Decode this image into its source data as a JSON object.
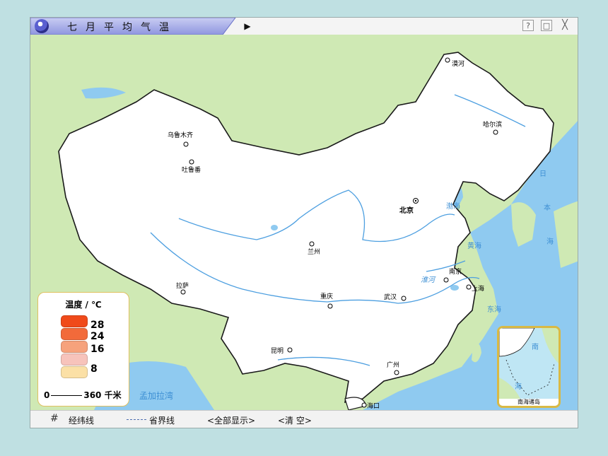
{
  "window": {
    "title": "七月平均气温",
    "help_button": "?",
    "restore_button": "□",
    "close_button": "╳",
    "play_button": "▶"
  },
  "map": {
    "cities": [
      {
        "name": "漠河"
      },
      {
        "name": "哈尔滨"
      },
      {
        "name": "乌鲁木齐"
      },
      {
        "name": "吐鲁番"
      },
      {
        "name": "北京"
      },
      {
        "name": "兰州"
      },
      {
        "name": "拉萨"
      },
      {
        "name": "重庆"
      },
      {
        "name": "武汉"
      },
      {
        "name": "南京"
      },
      {
        "name": "上海"
      },
      {
        "name": "昆明"
      },
      {
        "name": "广州"
      },
      {
        "name": "海口"
      }
    ],
    "water_labels": {
      "bohai": "渤海",
      "huanghai": "黄海",
      "donghai": "东海",
      "nanhai_1": "南",
      "nanhai_2": "海",
      "ri_1": "日",
      "ri_2": "本",
      "ri_3": "海",
      "menggala": "孟加拉湾",
      "huaihe": "淮河"
    },
    "inset": {
      "label": "南海诸岛",
      "nan": "南",
      "hai": "海"
    }
  },
  "legend": {
    "title": "温度 / ℃",
    "items": [
      {
        "value": "28",
        "color": "#f04a1a"
      },
      {
        "value": "24",
        "color": "#f26a3a"
      },
      {
        "value": "16",
        "color": "#f6a27c"
      },
      {
        "value": "",
        "color": "#f7c3bb"
      },
      {
        "value": "8",
        "color": "#fbe0a6"
      }
    ],
    "scale_start": "0",
    "scale_end": "360 千米"
  },
  "status_bar": {
    "grid_icon": "#",
    "grid_label": "经纬线",
    "province_label": "省界线",
    "show_all": "<全部显示>",
    "clear": "<清 空>"
  },
  "colors": {
    "land_neighbor": "#cfe9b4",
    "sea": "#8fcaf0",
    "china": "#ffffff",
    "border": "#1a1a1a",
    "river": "#4d9fe0"
  }
}
